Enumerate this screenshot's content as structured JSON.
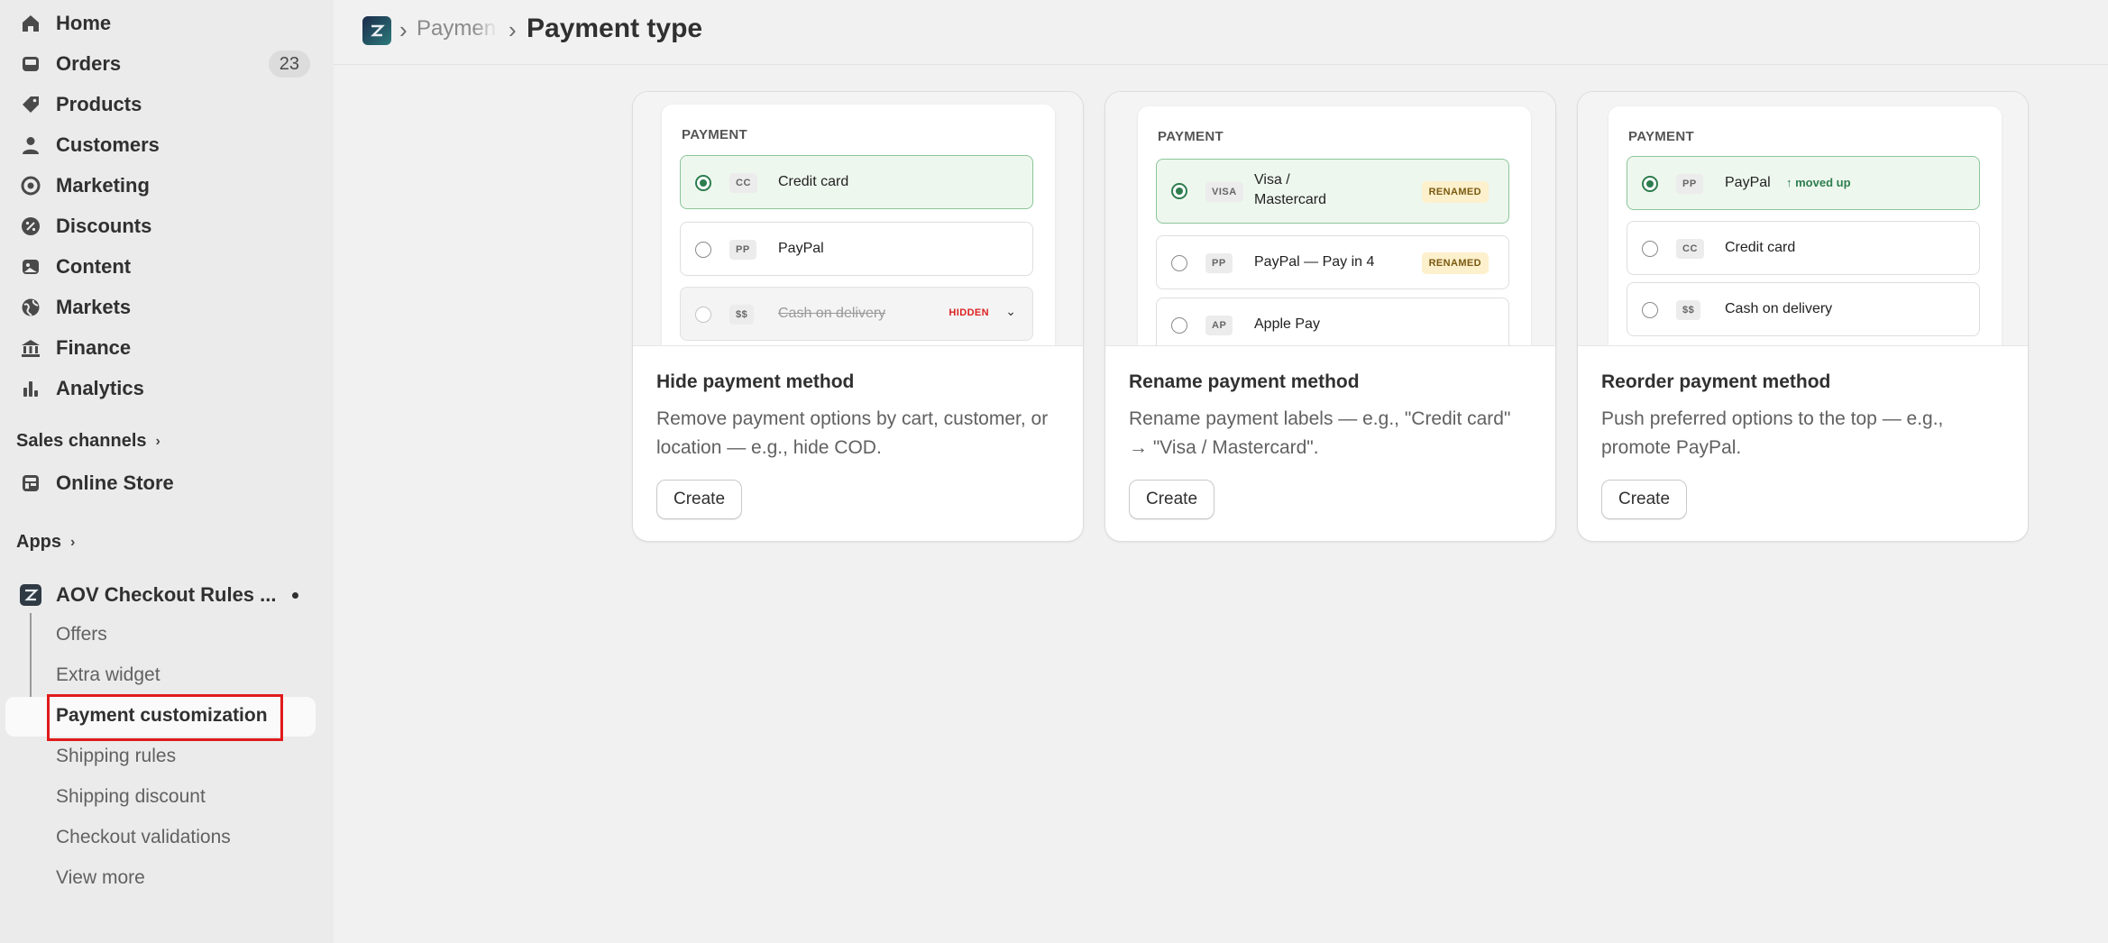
{
  "sidebar": {
    "nav": [
      {
        "label": "Home",
        "icon": "home-icon"
      },
      {
        "label": "Orders",
        "icon": "inbox-icon",
        "badge": "23"
      },
      {
        "label": "Products",
        "icon": "tag-icon"
      },
      {
        "label": "Customers",
        "icon": "person-icon"
      },
      {
        "label": "Marketing",
        "icon": "target-icon"
      },
      {
        "label": "Discounts",
        "icon": "discount-icon"
      },
      {
        "label": "Content",
        "icon": "content-icon"
      },
      {
        "label": "Markets",
        "icon": "globe-icon"
      },
      {
        "label": "Finance",
        "icon": "bank-icon"
      },
      {
        "label": "Analytics",
        "icon": "bar-chart-icon"
      }
    ],
    "sales_channels_label": "Sales channels",
    "online_store_label": "Online Store",
    "apps_label": "Apps",
    "app_name": "AOV Checkout Rules ...",
    "app_sub": [
      {
        "label": "Offers"
      },
      {
        "label": "Extra widget"
      },
      {
        "label": "Payment customization"
      },
      {
        "label": "Shipping rules"
      },
      {
        "label": "Shipping discount"
      },
      {
        "label": "Checkout validations"
      },
      {
        "label": "View more"
      }
    ]
  },
  "header": {
    "breadcrumb_prev": "Payment",
    "title": "Payment type"
  },
  "cards": [
    {
      "mock_heading": "PAYMENT",
      "options": [
        {
          "code": "CC",
          "label": "Credit card"
        },
        {
          "code": "PP",
          "label": "PayPal"
        },
        {
          "code": "$$",
          "label": "Cash on delivery",
          "tag": "HIDDEN"
        }
      ],
      "title": "Hide payment method",
      "description": "Remove payment options by cart, customer, or location — e.g., hide COD.",
      "button": "Create"
    },
    {
      "mock_heading": "PAYMENT",
      "options": [
        {
          "code": "VISA",
          "label": "Visa / Mastercard",
          "tag": "RENAMED"
        },
        {
          "code": "PP",
          "label": "PayPal — Pay in 4",
          "tag": "RENAMED"
        },
        {
          "code": "AP",
          "label": "Apple Pay"
        }
      ],
      "title": "Rename payment method",
      "description": "Rename payment labels — e.g., \"Credit card\" → \"Visa / Mastercard\".",
      "button": "Create"
    },
    {
      "mock_heading": "PAYMENT",
      "options": [
        {
          "code": "PP",
          "label": "PayPal",
          "tag": "↑ moved up"
        },
        {
          "code": "CC",
          "label": "Credit card"
        },
        {
          "code": "$$",
          "label": "Cash on delivery"
        }
      ],
      "title": "Reorder payment method",
      "description": "Push preferred options to the top — e.g., promote PayPal.",
      "button": "Create"
    }
  ],
  "colors": {
    "selected_green": "#2e7d4f",
    "hidden_red": "#dd2222",
    "highlight_red": "#e01b1b",
    "renamed_bg": "#fdf0cc"
  }
}
